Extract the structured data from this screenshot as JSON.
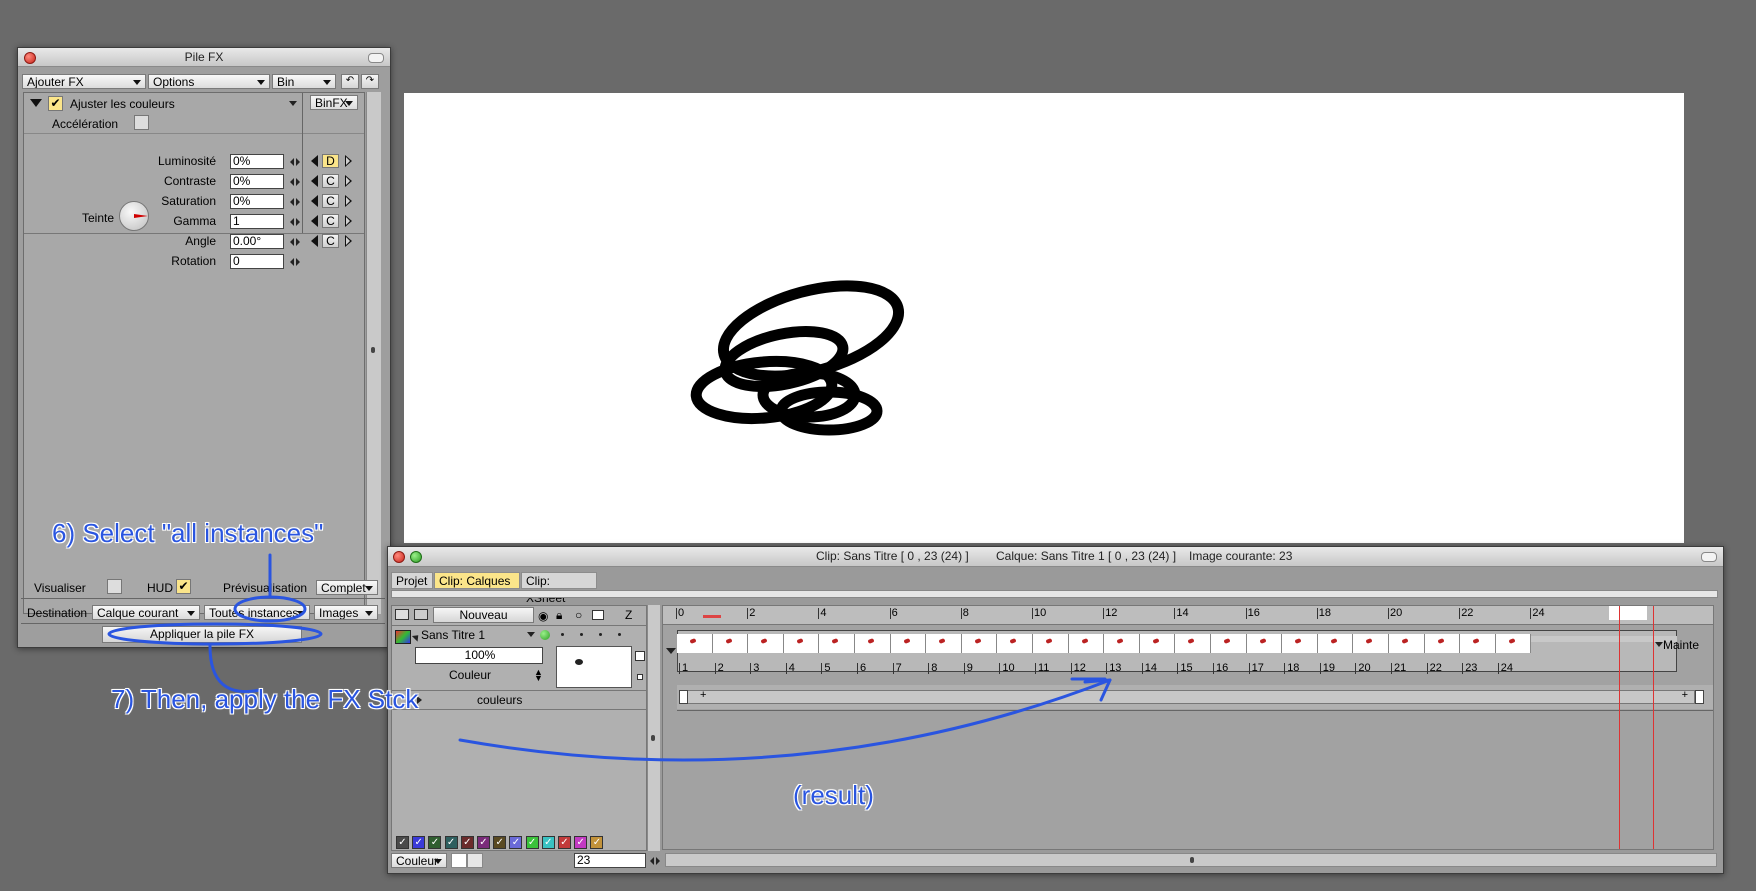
{
  "fx_panel": {
    "title": "Pile FX",
    "menus": [
      "Ajouter FX",
      "Options",
      "Bin"
    ],
    "effect_name": "Ajuster les couleurs",
    "binfx_label": "BinFX",
    "acceleration_label": "Accélération",
    "params": [
      {
        "label": "Luminosité",
        "value": "0%",
        "key": "D",
        "key_active": true
      },
      {
        "label": "Contraste",
        "value": "0%",
        "key": "C",
        "key_active": false
      },
      {
        "label": "Saturation",
        "value": "0%",
        "key": "C",
        "key_active": false
      },
      {
        "label": "Gamma",
        "value": "1",
        "key": "C",
        "key_active": false
      },
      {
        "label": "Angle",
        "value": "0.00°",
        "key": "C",
        "key_active": false
      },
      {
        "label": "Rotation",
        "value": "0",
        "key": "",
        "key_active": false
      }
    ],
    "teinte_label": "Teinte",
    "visualiser_label": "Visualiser",
    "hud_label": "HUD",
    "preview_label": "Prévisualisation",
    "preview_value": "Complet",
    "destination_label": "Destination",
    "destination_options": [
      "Calque courant",
      "Toutes instances",
      "Images"
    ],
    "apply_button": "Appliquer la pile FX"
  },
  "timeline": {
    "status_clip": "Clip: Sans Titre [ 0 , 23  (24) ]",
    "status_layer": "Calque: Sans Titre 1 [ 0 , 23  (24) ]",
    "status_image": "Image courante: 23",
    "tabs": [
      "Projet",
      "Clip: Calques",
      "Clip: XSheet"
    ],
    "active_tab": 1,
    "nouveau_label": "Nouveau",
    "z_label": "Z",
    "layer_name": "Sans Titre 1",
    "opacity": "100%",
    "blend_mode": "Couleur",
    "fx_layer_label": "couleurs",
    "ruler_numbers": [
      "0",
      "2",
      "4",
      "6",
      "8",
      "10",
      "12",
      "14",
      "16",
      "18",
      "20",
      "22",
      "24"
    ],
    "frame_numbers": [
      "1",
      "2",
      "3",
      "4",
      "5",
      "6",
      "7",
      "8",
      "9",
      "10",
      "11",
      "12",
      "13",
      "14",
      "15",
      "16",
      "17",
      "18",
      "19",
      "20",
      "21",
      "22",
      "23",
      "24"
    ],
    "maintenir_label": "Mainte",
    "bottom_color_label": "Couleur",
    "current_frame": "23",
    "swatch_colors": [
      "#4a4a4a",
      "#3a3ad8",
      "#2f5e2f",
      "#2e5f5f",
      "#6b2b2b",
      "#7a2b7a",
      "#5a4a22",
      "#6a6ad8",
      "#3ac23a",
      "#3ac2c2",
      "#c23a3a",
      "#c23ac2",
      "#c2923a"
    ]
  },
  "annotations": {
    "step6": "6) Select \"all instances\"",
    "step7": "7) Then, apply the FX Stck",
    "result": "(result)"
  }
}
